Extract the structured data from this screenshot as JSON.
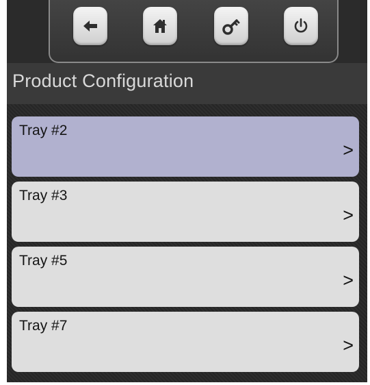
{
  "toolbar": {
    "buttons": [
      {
        "name": "back",
        "icon": "arrow-left-icon"
      },
      {
        "name": "home",
        "icon": "home-icon"
      },
      {
        "name": "key",
        "icon": "key-icon"
      },
      {
        "name": "power",
        "icon": "power-icon"
      }
    ],
    "icon_color": "#2e2e2e"
  },
  "page": {
    "title": "Product Configuration"
  },
  "trays": {
    "selected_color": "#b1b1cf",
    "items": [
      {
        "label": "Tray #2",
        "chevron": ">",
        "selected": true
      },
      {
        "label": "Tray #3",
        "chevron": ">",
        "selected": false
      },
      {
        "label": "Tray #5",
        "chevron": ">",
        "selected": false
      },
      {
        "label": "Tray #7",
        "chevron": ">",
        "selected": false
      }
    ]
  }
}
